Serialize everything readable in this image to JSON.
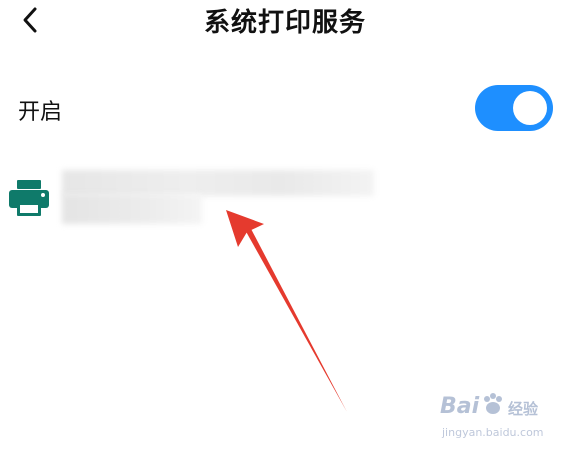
{
  "header": {
    "title": "系统打印服务",
    "back_icon": "chevron-left-icon"
  },
  "setting": {
    "label": "开启",
    "toggle_on": true,
    "toggle_color": "#1e8fff"
  },
  "printer": {
    "icon": "printer-icon",
    "icon_color": "#0f7a6a"
  },
  "annotation": {
    "arrow_color": "#e53a2e"
  },
  "watermark": {
    "logo": "Bai",
    "text": "经验",
    "url": "jingyan.baidu.com"
  }
}
